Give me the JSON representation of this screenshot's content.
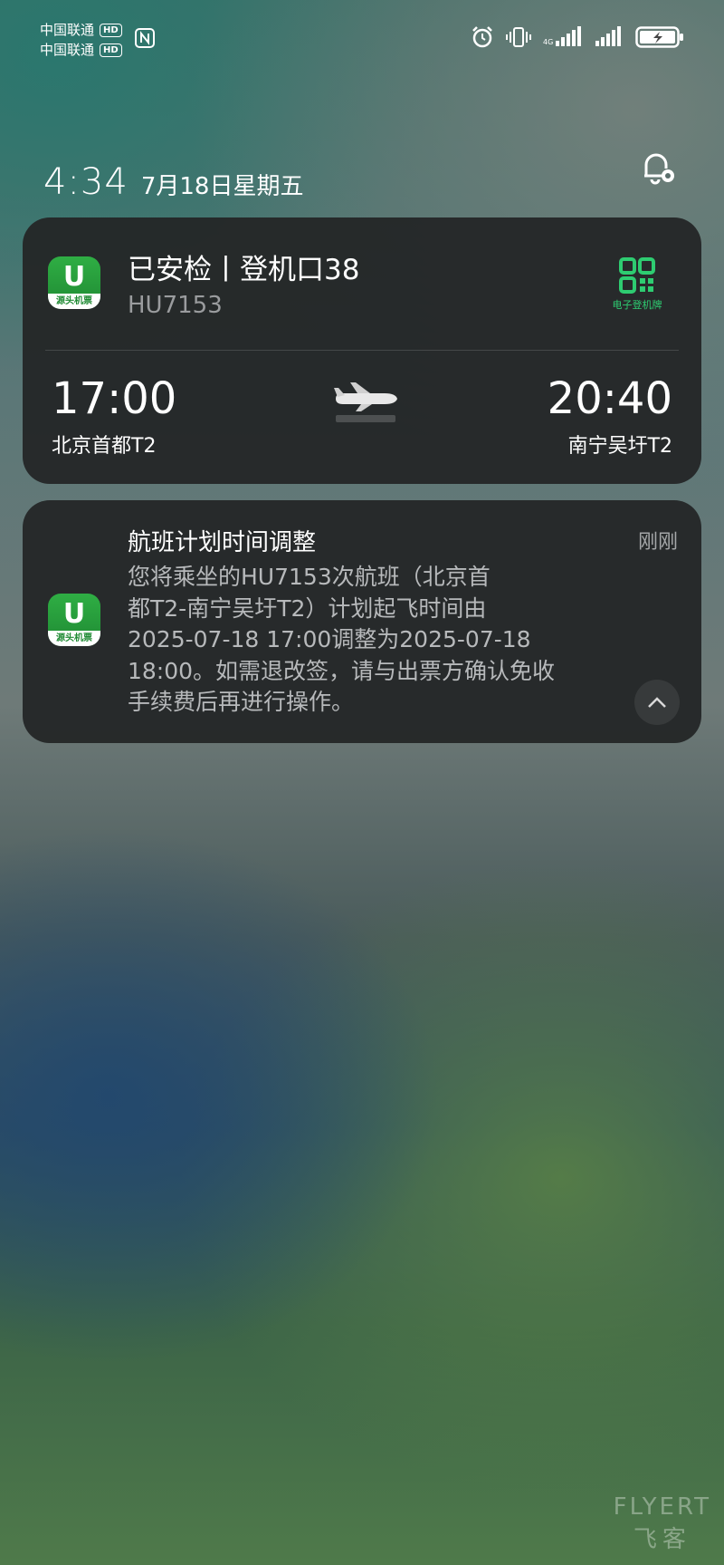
{
  "status_bar": {
    "carriers": [
      "中国联通",
      "中国联通"
    ],
    "hd_badge": "HD",
    "icons": [
      "nfc-icon",
      "alarm-icon",
      "vibrate-icon",
      "signal-icon",
      "signal-icon",
      "battery-charging-icon"
    ]
  },
  "lockscreen": {
    "time": "4:34",
    "date": "7月18日星期五"
  },
  "flight_card": {
    "app_icon_label": "源头机票",
    "title": "已安检丨登机口38",
    "flight_number": "HU7153",
    "boarding_pass_label": "电子登机牌",
    "departure": {
      "time": "17:00",
      "airport": "北京首都T2"
    },
    "arrival": {
      "time": "20:40",
      "airport": "南宁吴圩T2"
    }
  },
  "notice_card": {
    "app_icon_label": "源头机票",
    "title": "航班计划时间调整",
    "time": "刚刚",
    "lines": [
      "您将乘坐的HU7153次航班（北京首",
      "都T2-南宁吴圩T2）计划起飞时间由",
      "2025-07-18 17:00调整为2025-07-18",
      "18:00。如需退改签，请与出票方确认免收",
      "手续费后再进行操作。"
    ]
  },
  "watermark": {
    "en": "FLYERT",
    "zh": "飞客"
  },
  "colors": {
    "accent_green": "#2ecc71",
    "card_bg": "#242628"
  }
}
